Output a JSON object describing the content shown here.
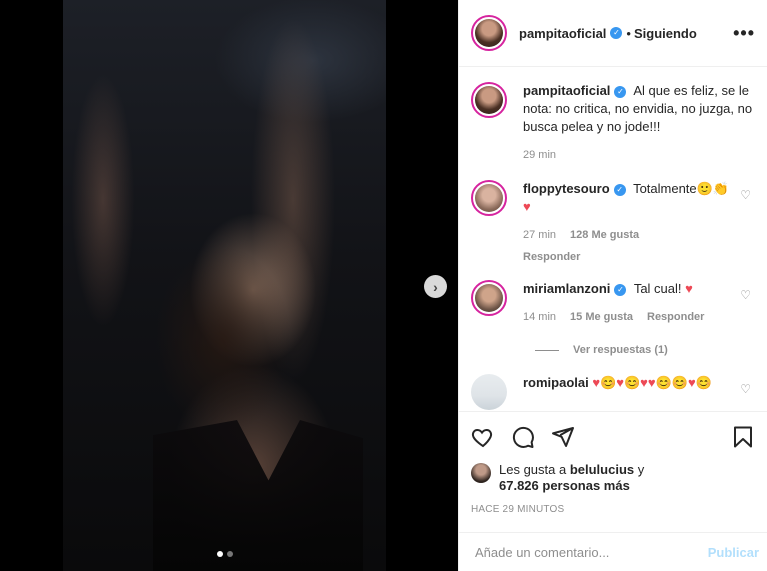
{
  "post": {
    "carousel": {
      "current": 1,
      "total": 2
    }
  },
  "header": {
    "username": "pampitaoficial",
    "separator": "•",
    "follow_status": "Siguiendo",
    "more_label": "•••"
  },
  "caption": {
    "username": "pampitaoficial",
    "text": "Al que es feliz, se le nota: no critica, no envidia, no juzga, no busca pelea y no jode!!!",
    "time": "29 min"
  },
  "comments": [
    {
      "username": "floppytesouro",
      "text": "Totalmente🙂👏",
      "extra": "♥",
      "time": "27 min",
      "likes": "128 Me gusta",
      "reply": "Responder"
    },
    {
      "username": "miriamlanzoni",
      "text": "Tal cual!",
      "extra": "♥",
      "time": "14 min",
      "likes": "15 Me gusta",
      "reply": "Responder"
    },
    {
      "username": "romipaolai",
      "text": "♥😊♥😊♥♥😊😊♥😊"
    }
  ],
  "view_replies": "Ver respuestas (1)",
  "likes": {
    "prefix": "Les gusta a ",
    "user": "belulucius",
    "suffix": " y",
    "count": "67.826 personas más"
  },
  "timestamp": "HACE 29 MINUTOS",
  "add_comment": {
    "placeholder": "Añade un comentario...",
    "publish_label": "Publicar"
  },
  "icons": {
    "like": "heart-icon",
    "comment": "comment-icon",
    "share": "share-icon",
    "save": "bookmark-icon",
    "next": "chevron-right-icon",
    "verified": "verified-badge-icon"
  },
  "colors": {
    "verified": "#3897f0",
    "heart": "#ed4956",
    "publish_disabled": "#b2dffc",
    "muted": "#8e8e8e"
  }
}
